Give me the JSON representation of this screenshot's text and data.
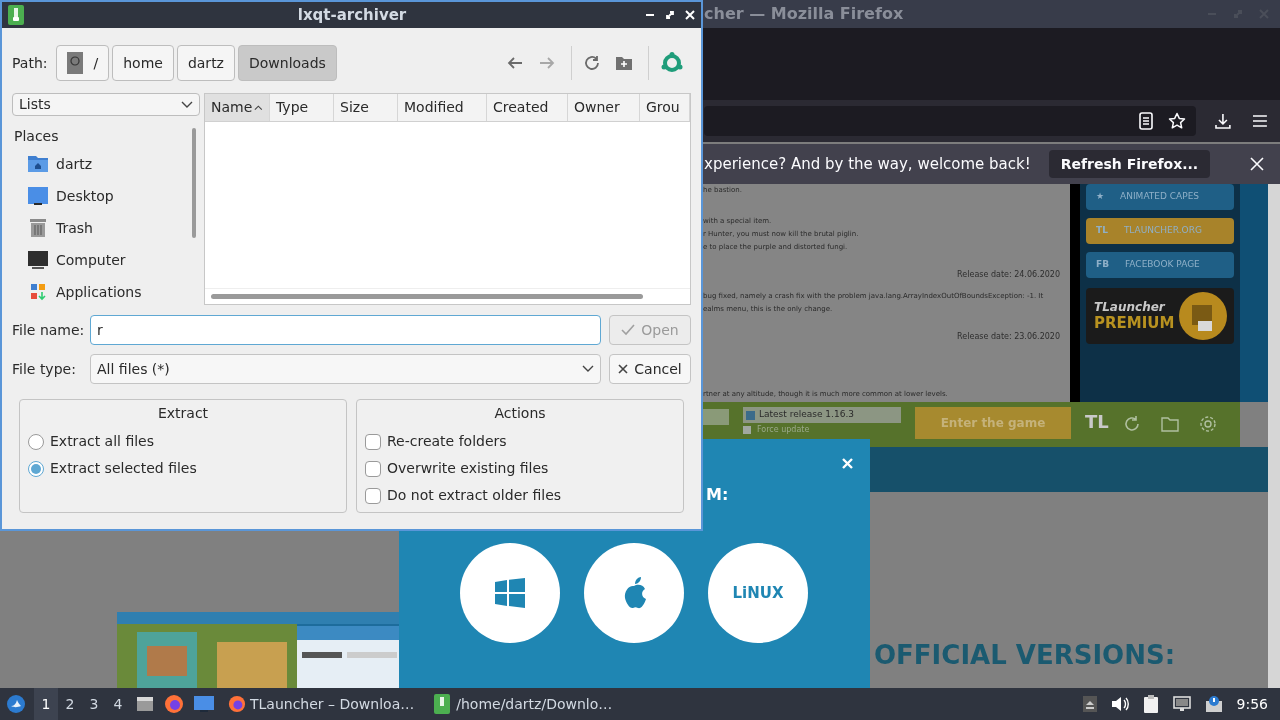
{
  "browser": {
    "title": "cher — Mozilla Firefox",
    "notification": {
      "message": "xperience? And by the way, welcome back!",
      "button": "Refresh Firefox..."
    },
    "page": {
      "lines": [
        {
          "kind": "text",
          "text": "he bastion."
        },
        {
          "kind": "gap"
        },
        {
          "kind": "text",
          "text": "with a special item."
        },
        {
          "kind": "text",
          "text": "r Hunter, you must now kill the brutal piglin."
        },
        {
          "kind": "text",
          "text": "e to place the purple and distorted fungi."
        },
        {
          "kind": "date",
          "text": "Release date: 24.06.2020"
        },
        {
          "kind": "text",
          "text": "bug fixed, namely a crash fix with the problem java.lang.ArrayIndexOutOfBoundsException: -1. It"
        },
        {
          "kind": "text",
          "text": "ealms menu, this is the only change."
        },
        {
          "kind": "date",
          "text": "Release date: 23.06.2020"
        },
        {
          "kind": "gap"
        },
        {
          "kind": "gap"
        },
        {
          "kind": "text",
          "text": "rtner at any altitude, though it is much more common at lower levels."
        }
      ],
      "sidebar": [
        {
          "tag": "★",
          "label": "ANIMATED CAPES",
          "color": "#1f5f86"
        },
        {
          "tag": "TL",
          "label": "TLAUNCHER.ORG",
          "color": "#a8832a"
        },
        {
          "tag": "FB",
          "label": "FACEBOOK PAGE",
          "color": "#1f5f86"
        }
      ],
      "premium": {
        "line1": "TLauncher",
        "line2": "PREMIUM"
      },
      "version_select": "Latest release 1.16.3",
      "force_update": "Force update",
      "force_update_checked": false,
      "play_button": "Enter the game",
      "mods_logo": "TL",
      "modal": {
        "heading": "M:",
        "os": [
          {
            "kind": "windows"
          },
          {
            "kind": "apple"
          },
          {
            "kind": "linux",
            "label": "LiNUX"
          }
        ]
      },
      "headline": "OFFICIAL VERSIONS:"
    }
  },
  "dialog": {
    "title": "lxqt-archiver",
    "path_label": "Path:",
    "path": [
      {
        "label": "/",
        "kind": "root",
        "selected": false
      },
      {
        "label": "home",
        "selected": false
      },
      {
        "label": "dartz",
        "selected": false
      },
      {
        "label": "Downloads",
        "selected": true
      }
    ],
    "view": "Lists",
    "places_heading": "Places",
    "places": [
      {
        "label": "dartz",
        "kind": "home"
      },
      {
        "label": "Desktop",
        "kind": "desktop"
      },
      {
        "label": "Trash",
        "kind": "trash"
      },
      {
        "label": "Computer",
        "kind": "computer"
      },
      {
        "label": "Applications",
        "kind": "apps"
      }
    ],
    "columns": [
      {
        "label": "Name",
        "sorted": true
      },
      {
        "label": "Type",
        "sorted": false
      },
      {
        "label": "Size",
        "sorted": false
      },
      {
        "label": "Modified",
        "sorted": false
      },
      {
        "label": "Created",
        "sorted": false
      },
      {
        "label": "Owner",
        "sorted": false
      },
      {
        "label": "Grou",
        "sorted": false
      }
    ],
    "file_name_label": "File name:",
    "file_name": "r",
    "open_button": {
      "label": "Open",
      "disabled": true
    },
    "file_type_label": "File type:",
    "file_type": "All files (*)",
    "cancel_button": "Cancel",
    "extract": {
      "title": "Extract",
      "options": [
        {
          "label": "Extract all files",
          "selected": false
        },
        {
          "label": "Extract selected files",
          "selected": true
        }
      ]
    },
    "actions": {
      "title": "Actions",
      "options": [
        {
          "label": "Re-create folders",
          "checked": false
        },
        {
          "label": "Overwrite existing files",
          "checked": false
        },
        {
          "label": "Do not extract older files",
          "checked": false
        }
      ]
    }
  },
  "taskbar": {
    "workspaces": [
      {
        "label": "1",
        "selected": true
      },
      {
        "label": "2",
        "selected": false
      },
      {
        "label": "3",
        "selected": false
      },
      {
        "label": "4",
        "selected": false
      }
    ],
    "tasks": [
      {
        "label": "TLauncher – Downloa…",
        "kind": "firefox"
      },
      {
        "label": "/home/dartz/Downlo…",
        "kind": "archiver"
      }
    ],
    "clock": "9:56"
  }
}
